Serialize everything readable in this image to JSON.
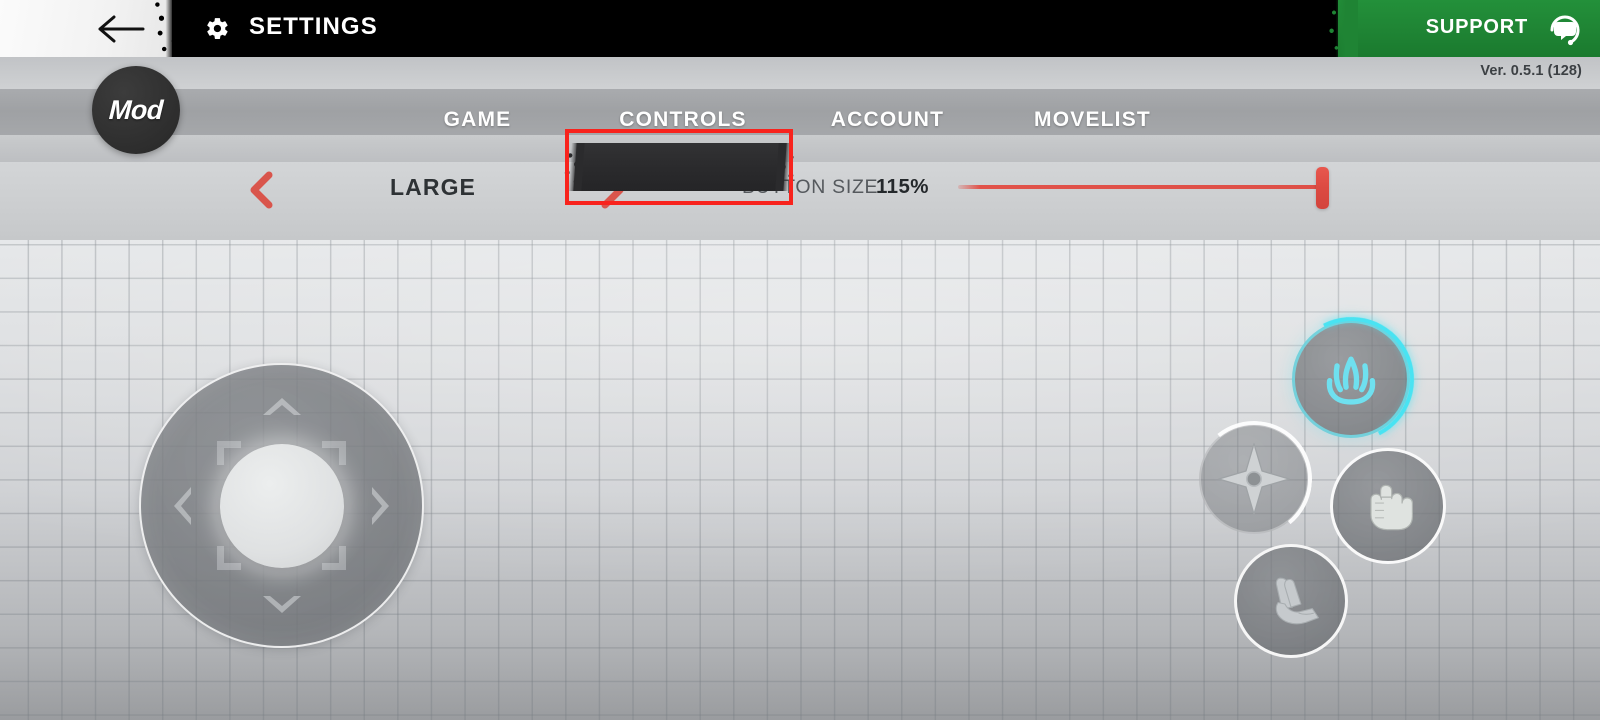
{
  "header": {
    "back_icon": "back-arrow-icon",
    "gear_icon": "gear-icon",
    "title": "SETTINGS",
    "support_label": "SUPPORT",
    "support_icon": "headset-support-icon",
    "support_color": "#1f8434"
  },
  "version": "Ver. 0.5.1 (128)",
  "brand": {
    "badge_text": "Mod"
  },
  "tabs": [
    {
      "label": "GAME",
      "active": false
    },
    {
      "label": "CONTROLS",
      "active": true
    },
    {
      "label": "ACCOUNT",
      "active": false
    },
    {
      "label": "MOVELIST",
      "active": false
    }
  ],
  "highlight": {
    "target": "CONTROLS",
    "color": "#f8231d"
  },
  "controls_settings": {
    "layout_preset": {
      "value": "LARGE",
      "prev_icon": "chevron-left-icon",
      "next_icon": "chevron-right-icon",
      "arrow_color": "#d9554c"
    },
    "button_size": {
      "label": "BUTTON SIZE",
      "value": "115%",
      "slider_percent": 100,
      "accent_color": "#de4f47"
    }
  },
  "preview": {
    "dpad": {
      "name": "virtual-joystick",
      "directions": [
        "up",
        "down",
        "left",
        "right"
      ]
    },
    "action_buttons": [
      {
        "name": "chakra-button",
        "icon": "flame-chakra-icon",
        "color": "#49e3f2",
        "cooldown": true
      },
      {
        "name": "shuriken-button",
        "icon": "shuriken-icon",
        "color": "#ffffff",
        "cooldown": true
      },
      {
        "name": "punch-button",
        "icon": "fist-icon",
        "color": "#ffffff",
        "cooldown": false
      },
      {
        "name": "hand-seal-button",
        "icon": "hand-seal-icon",
        "color": "#ffffff",
        "cooldown": false
      }
    ]
  }
}
